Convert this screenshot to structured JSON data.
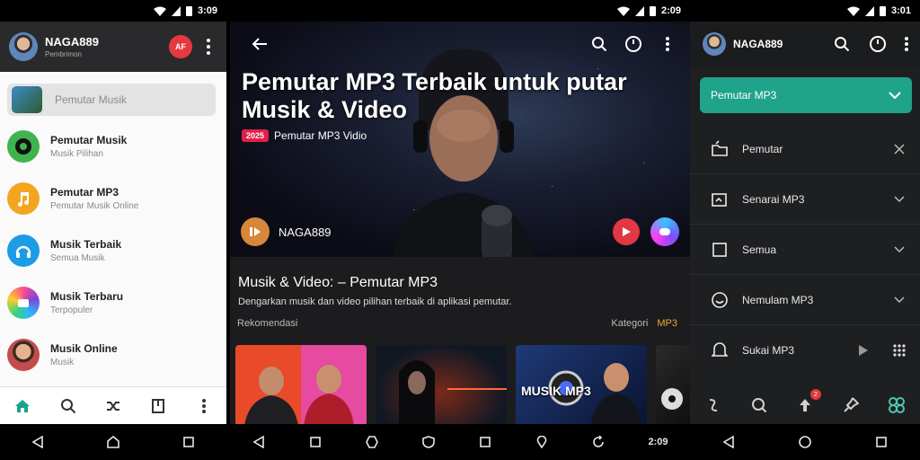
{
  "status": {
    "left_time": "3:09",
    "mid_time": "2:09",
    "right_time": "3:01"
  },
  "screen1": {
    "app_name": "NAGA889",
    "app_sub": "Pembrimon",
    "badge": "AF",
    "search_placeholder": "Pemutar Musik",
    "items": [
      {
        "title": "Pemutar Musik",
        "sub": "Musik Pilihan",
        "color": "#3fb34f"
      },
      {
        "title": "Pemutar MP3",
        "sub": "Pemutar Musik Online",
        "color": "#f3a51f"
      },
      {
        "title": "Musik Terbaik",
        "sub": "Semua Musik",
        "color": "#1c9be6"
      },
      {
        "title": "Musik Terbaru",
        "sub": "Terpopuler",
        "color": "#7b47d9"
      },
      {
        "title": "Musik Online",
        "sub": "Musik",
        "color": "#c44b4b"
      }
    ]
  },
  "screen2": {
    "title": "Pemutar MP3 Terbaik untuk putar Musik & Video",
    "tag": "2025",
    "subtitle": "Pemutar MP3 Vidio",
    "brand": "NAGA889",
    "section_title": "Musik & Video: – Pemutar MP3",
    "section_desc": "Dengarkan musik dan video pilihan terbaik di aplikasi pemutar.",
    "row_left": "Rekomendasi",
    "row_right": "Kategori",
    "row_mp3": "MP3",
    "card_label": "MUSIK MP3"
  },
  "screen3": {
    "app_name": "NAGA889",
    "selected": "Pemutar MP3",
    "menu": [
      {
        "label": "Pemutar",
        "end": "close"
      },
      {
        "label": "Senarai MP3",
        "end": "chevron"
      },
      {
        "label": "Semua",
        "end": "chevron"
      },
      {
        "label": "Nemulam MP3",
        "end": "chevron"
      },
      {
        "label": "Sukai MP3",
        "end": "play"
      }
    ],
    "nav_badge": "2"
  }
}
